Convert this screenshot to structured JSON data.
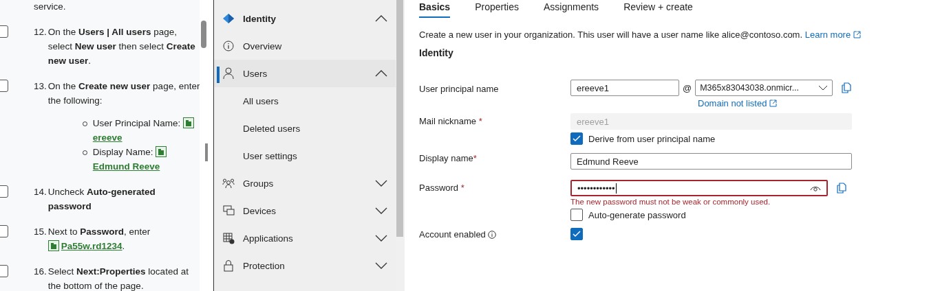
{
  "instructions": {
    "continued_text": "service.",
    "steps": [
      {
        "number": "12.",
        "checked": false,
        "text": "On the **Users | All users** page, select **New user** then select **Create new user**."
      },
      {
        "number": "13.",
        "checked": false,
        "text": "On the **Create new user** page, enter the following:",
        "bullets": [
          {
            "label": "User Principal Name:",
            "copy_text": "ereeve"
          },
          {
            "label": "Display Name:",
            "copy_text": "Edmund Reeve"
          }
        ]
      },
      {
        "number": "14.",
        "checked": false,
        "text": "Uncheck **Auto-generated password**"
      },
      {
        "number": "15.",
        "checked": false,
        "text": "Next to **Password**, enter",
        "copy_text": "Pa55w.rd1234",
        "suffix": "."
      },
      {
        "number": "16.",
        "checked": false,
        "text": "Select **Next:Properties** located at the bottom of the page."
      }
    ]
  },
  "nav": {
    "items": [
      {
        "kind": "header",
        "label": "Identity",
        "expanded": true,
        "selected": false
      },
      {
        "kind": "item",
        "label": "Overview",
        "selected": false
      },
      {
        "kind": "item",
        "label": "Users",
        "expanded": true,
        "selected": true
      },
      {
        "kind": "subitem",
        "label": "All users",
        "selected": false
      },
      {
        "kind": "subitem",
        "label": "Deleted users",
        "selected": false
      },
      {
        "kind": "subitem",
        "label": "User settings",
        "selected": false
      },
      {
        "kind": "item",
        "label": "Groups",
        "expanded": false,
        "selected": false
      },
      {
        "kind": "item",
        "label": "Devices",
        "expanded": false,
        "selected": false
      },
      {
        "kind": "item",
        "label": "Applications",
        "expanded": false,
        "selected": false
      },
      {
        "kind": "item",
        "label": "Protection",
        "expanded": false,
        "selected": false
      }
    ]
  },
  "form": {
    "tabs": [
      {
        "label": "Basics",
        "selected": true
      },
      {
        "label": "Properties",
        "selected": false
      },
      {
        "label": "Assignments",
        "selected": false
      },
      {
        "label": "Review + create",
        "selected": false
      }
    ],
    "description": "Create a new user in your organization. This user will have a user name like alice@contoso.com.",
    "learn_more": "Learn more",
    "section_title": "Identity",
    "upn": {
      "label": "User principal name",
      "value": "ereeve1",
      "at": "@",
      "domain": "M365x83043038.onmicr...",
      "domain_link": "Domain not listed"
    },
    "mail_nickname": {
      "label": "Mail nickname",
      "required_mark": " *",
      "value": "ereeve1",
      "disabled": true,
      "derive_label": "Derive from user principal name",
      "derive_checked": true
    },
    "display_name": {
      "label": "Display name",
      "required_mark": "*",
      "value": "Edmund Reeve"
    },
    "password": {
      "label": "Password",
      "required_mark": " *",
      "value": "••••••••••••",
      "error": "The new password must not be weak or commonly used.",
      "auto_label": "Auto-generate password",
      "auto_checked": false
    },
    "account_enabled": {
      "label": "Account enabled",
      "checked": true
    }
  }
}
